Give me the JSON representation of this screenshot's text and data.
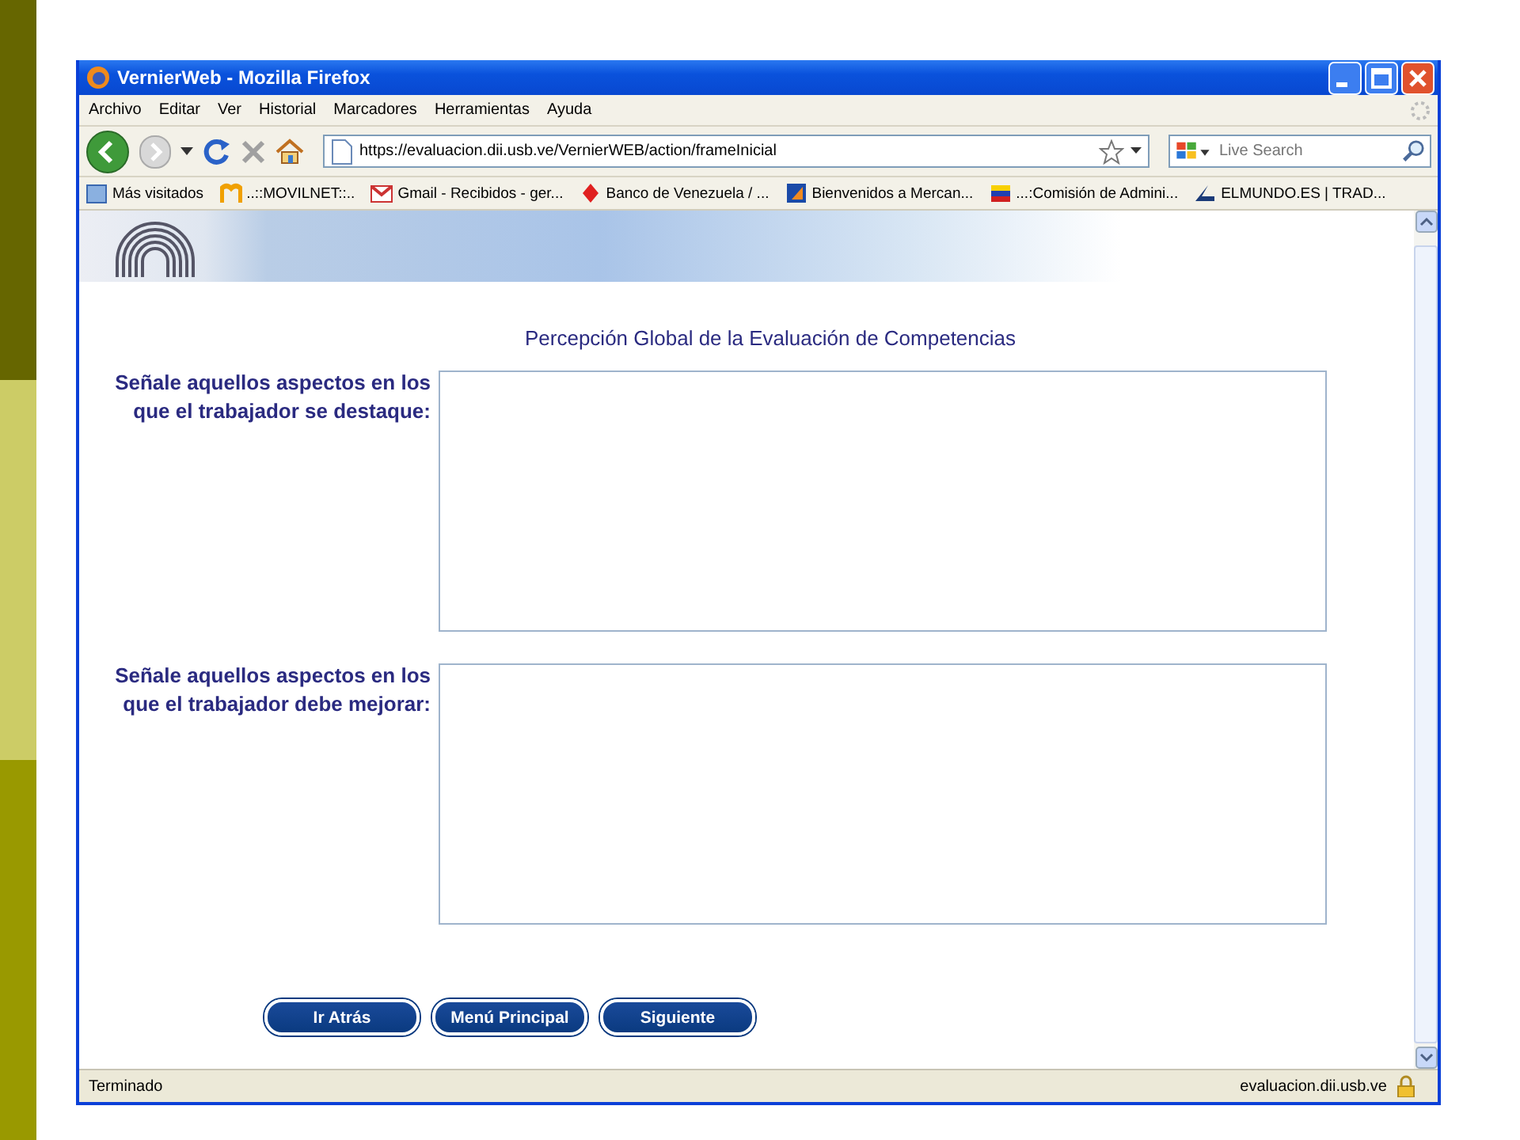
{
  "window": {
    "title": "VernierWeb - Mozilla Firefox"
  },
  "menu": [
    "Archivo",
    "Editar",
    "Ver",
    "Historial",
    "Marcadores",
    "Herramientas",
    "Ayuda"
  ],
  "navigation": {
    "url": "https://evaluacion.dii.usb.ve/VernierWEB/action/frameInicial",
    "search_placeholder": "Live Search"
  },
  "bookmarks": [
    "Más visitados",
    "..::MOVILNET::..",
    "Gmail - Recibidos - ger...",
    "Banco de Venezuela / ...",
    "Bienvenidos a Mercan...",
    "...:Comisión de Admini...",
    "ELMUNDO.ES | TRAD..."
  ],
  "form": {
    "heading": "Percepción Global de la Evaluación de Competencias",
    "fields": [
      {
        "label": "Señale aquellos aspectos en los que el trabajador se destaque:"
      },
      {
        "label": "Señale aquellos aspectos en los que el trabajador debe mejorar:"
      }
    ],
    "buttons": [
      "Ir Atrás",
      "Menú Principal",
      "Siguiente"
    ]
  },
  "status_bar": {
    "text": "Terminado",
    "domain": "evaluacion.dii.usb.ve"
  }
}
